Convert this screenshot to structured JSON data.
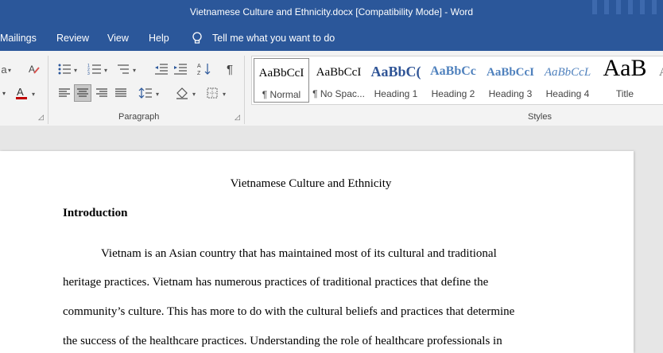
{
  "window": {
    "title": "Vietnamese Culture and Ethnicity.docx [Compatibility Mode]  -  Word"
  },
  "menu": {
    "items": [
      "Mailings",
      "Review",
      "View",
      "Help"
    ],
    "tell_me": "Tell me what you want to do"
  },
  "ribbon": {
    "paragraph_label": "Paragraph",
    "styles_label": "Styles",
    "styles": [
      {
        "preview": "AaBbCcI",
        "label": "¶ Normal"
      },
      {
        "preview": "AaBbCcI",
        "label": "¶ No Spac..."
      },
      {
        "preview": "AaBbC(",
        "label": "Heading 1"
      },
      {
        "preview": "AaBbCc",
        "label": "Heading 2"
      },
      {
        "preview": "AaBbCcI",
        "label": "Heading 3"
      },
      {
        "preview": "AaBbCcL",
        "label": "Heading 4"
      },
      {
        "preview": "AaB",
        "label": "Title"
      },
      {
        "preview": "A",
        "label": ""
      }
    ],
    "pilcrow": "¶"
  },
  "document": {
    "title": "Vietnamese Culture and Ethnicity",
    "heading": "Introduction",
    "lines": [
      "Vietnam is an Asian country that has maintained most of its cultural and traditional",
      "heritage practices. Vietnam has numerous practices of traditional practices that define the",
      "community’s culture. This has more to do with the cultural beliefs and practices that determine",
      "the success of the healthcare practices. Understanding the role of healthcare professionals in"
    ]
  },
  "colors": {
    "accent": "#2b579a",
    "heading_blue": "#2f5496",
    "font_red": "#c00000"
  }
}
